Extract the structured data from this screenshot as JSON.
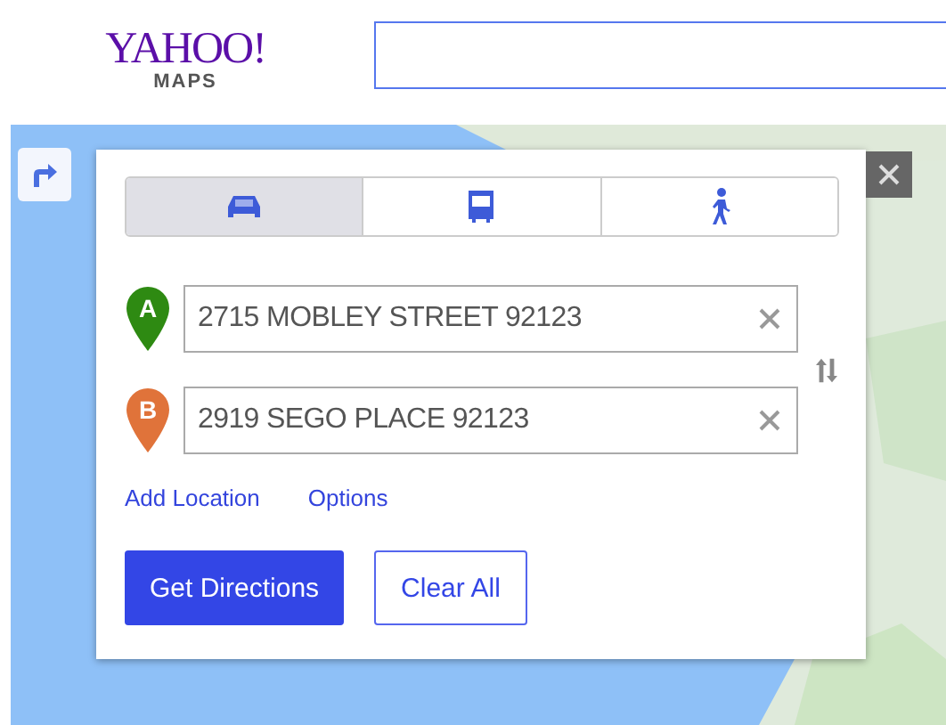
{
  "header": {
    "logo": {
      "name": "YAHOO!",
      "product": "MAPS"
    }
  },
  "directions": {
    "modes": [
      {
        "kind": "car",
        "selected": true
      },
      {
        "kind": "bus",
        "selected": false
      },
      {
        "kind": "walk",
        "selected": false
      }
    ],
    "stops": [
      {
        "marker": "A",
        "color": "#2e8a12",
        "value": "2715 MOBLEY STREET 92123"
      },
      {
        "marker": "B",
        "color": "#e0733a",
        "value": "2919 SEGO PLACE 92123"
      }
    ],
    "links": [
      "Add Location",
      "Options"
    ],
    "buttons": [
      {
        "label": "Get Directions",
        "kind": "primary"
      },
      {
        "label": "Clear All",
        "kind": "secondary"
      }
    ]
  }
}
